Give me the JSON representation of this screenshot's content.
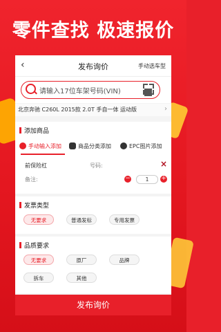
{
  "headline": "零件查找  极速报价",
  "header": {
    "back_icon": "‹",
    "title": "发布询价",
    "right_link": "手动选车型"
  },
  "search": {
    "placeholder": "请输入17位车架号码(VIN)"
  },
  "car": {
    "model": "北京奔驰 C260L 2015款 2.0T 手自一体 运动版"
  },
  "add_goods": {
    "title": "添加商品",
    "tabs": [
      {
        "label": "手动输入添加"
      },
      {
        "label": "商品分类添加"
      },
      {
        "label": "EPC图片添加"
      }
    ],
    "item": {
      "name": "前保险杠",
      "part_no_label": "号码:",
      "note_label": "备注:",
      "quantity": "1"
    }
  },
  "invoice": {
    "title": "发票类型",
    "options": [
      "无要求",
      "普通发标",
      "专用发票"
    ],
    "selected": "无要求"
  },
  "quality": {
    "title": "品质要求",
    "options": [
      "无要求",
      "原厂",
      "品牌",
      "拆车",
      "其他"
    ],
    "selected": "无要求"
  },
  "submit_label": "发布询价",
  "colors": {
    "brand_red": "#e8202a",
    "background_red": "#e3161f",
    "accent_yellow": "#ffcc33"
  }
}
